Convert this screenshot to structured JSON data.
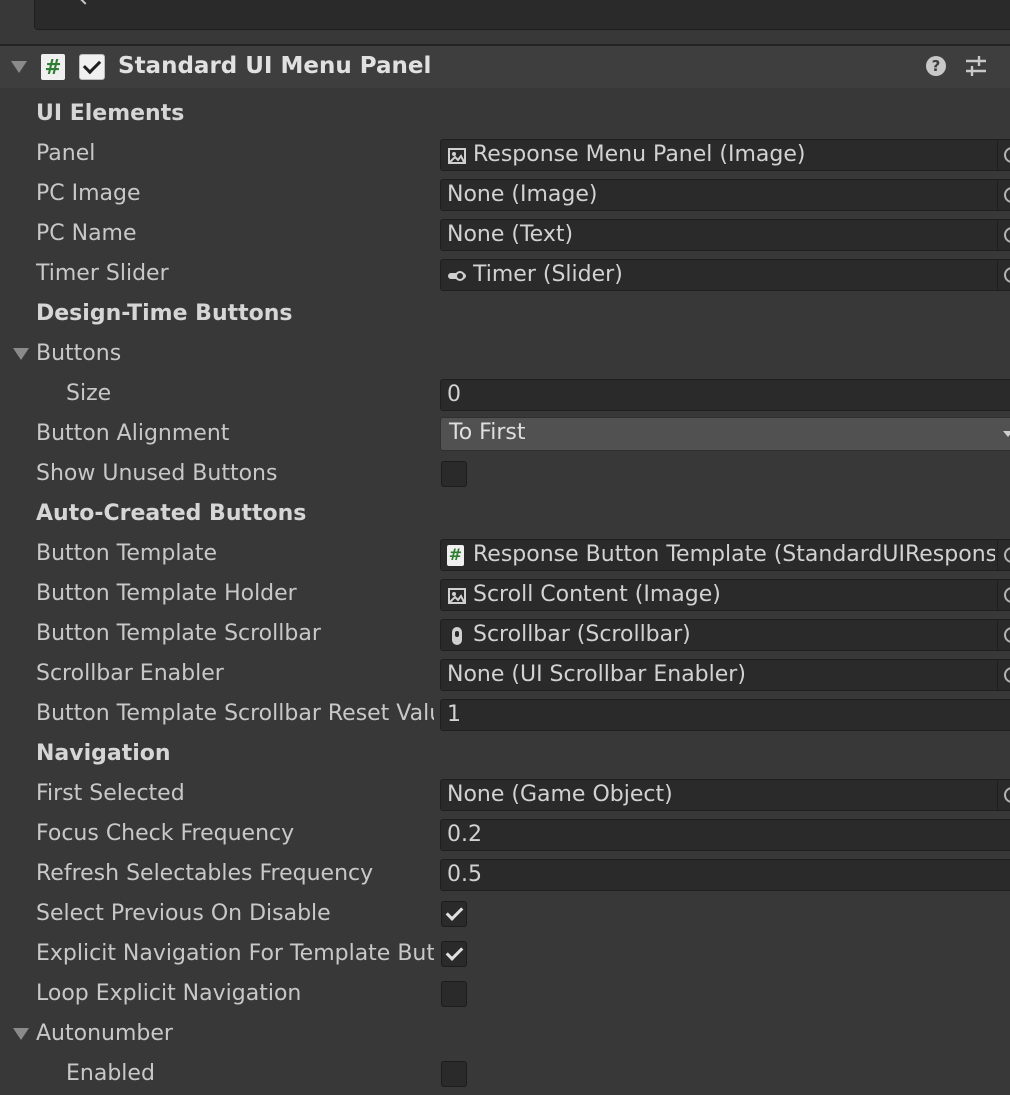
{
  "component": {
    "title": "Standard UI Menu Panel",
    "enabled": true,
    "help_icon": "help-icon",
    "preset_icon": "presets-icon"
  },
  "sections": {
    "ui_elements": "UI Elements",
    "design_time_buttons": "Design-Time Buttons",
    "auto_created_buttons": "Auto-Created Buttons",
    "navigation": "Navigation"
  },
  "fields": {
    "panel": {
      "label": "Panel",
      "value": "Response Menu Panel (Image)",
      "icon": "image-icon"
    },
    "pc_image": {
      "label": "PC Image",
      "value": "None (Image)"
    },
    "pc_name": {
      "label": "PC Name",
      "value": "None (Text)"
    },
    "timer_slider": {
      "label": "Timer Slider",
      "value": "Timer (Slider)",
      "icon": "slider-icon"
    },
    "buttons": {
      "label": "Buttons",
      "expanded": true
    },
    "size": {
      "label": "Size",
      "value": "0"
    },
    "button_alignment": {
      "label": "Button Alignment",
      "value": "To First"
    },
    "show_unused_buttons": {
      "label": "Show Unused Buttons",
      "checked": false
    },
    "button_template": {
      "label": "Button Template",
      "value": "Response Button Template (StandardUIResponseButton)",
      "icon": "script-icon"
    },
    "button_template_holder": {
      "label": "Button Template Holder",
      "value": "Scroll Content (Image)",
      "icon": "image-icon"
    },
    "button_template_scrollbar": {
      "label": "Button Template Scrollbar",
      "value": "Scrollbar (Scrollbar)",
      "icon": "scrollbar-icon"
    },
    "scrollbar_enabler": {
      "label": "Scrollbar Enabler",
      "value": "None (UI Scrollbar Enabler)"
    },
    "scrollbar_reset_value": {
      "label": "Button Template Scrollbar Reset Value",
      "value": "1"
    },
    "first_selected": {
      "label": "First Selected",
      "value": "None (Game Object)"
    },
    "focus_check_frequency": {
      "label": "Focus Check Frequency",
      "value": "0.2"
    },
    "refresh_selectables_frequency": {
      "label": "Refresh Selectables Frequency",
      "value": "0.5"
    },
    "select_previous_on_disable": {
      "label": "Select Previous On Disable",
      "checked": true
    },
    "explicit_navigation": {
      "label": "Explicit Navigation For Template Buttons",
      "checked": true
    },
    "loop_explicit_navigation": {
      "label": "Loop Explicit Navigation",
      "checked": false
    },
    "autonumber": {
      "label": "Autonumber",
      "expanded": true
    },
    "enabled": {
      "label": "Enabled",
      "checked": false
    }
  }
}
